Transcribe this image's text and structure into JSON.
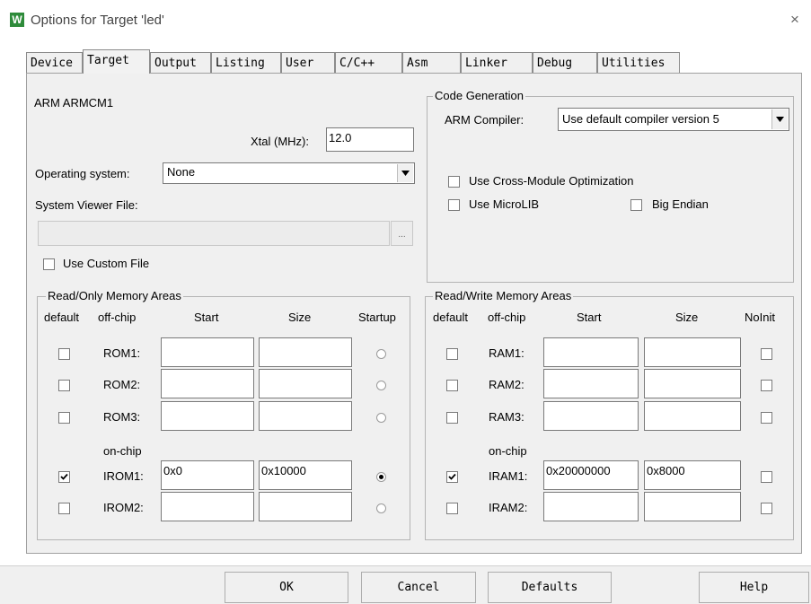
{
  "window": {
    "title": "Options for Target 'led'",
    "close_glyph": "×",
    "app_icon_letter": "W"
  },
  "tabs": [
    "Device",
    "Target",
    "Output",
    "Listing",
    "User",
    "C/C++",
    "Asm",
    "Linker",
    "Debug",
    "Utilities"
  ],
  "active_tab": "Target",
  "target": {
    "device_name": "ARM ARMCM1",
    "xtal_label": "Xtal (MHz):",
    "xtal_value": "12.0",
    "os_label": "Operating system:",
    "os_value": "None",
    "svf_label": "System Viewer File:",
    "svf_value": "",
    "browse_label": "...",
    "use_custom_file_label": "Use Custom File",
    "use_custom_file_checked": false
  },
  "code_generation": {
    "legend": "Code Generation",
    "compiler_label": "ARM Compiler:",
    "compiler_value": "Use default compiler version 5",
    "cross_module_label": "Use Cross-Module Optimization",
    "cross_module_checked": false,
    "microlib_label": "Use MicroLIB",
    "microlib_checked": false,
    "big_endian_label": "Big Endian",
    "big_endian_checked": false
  },
  "rom": {
    "legend": "Read/Only Memory Areas",
    "headers": {
      "default": "default",
      "offchip": "off-chip",
      "start": "Start",
      "size": "Size",
      "last": "Startup"
    },
    "onchip_label": "on-chip",
    "rows": [
      {
        "label": "ROM1:",
        "default": false,
        "start": "",
        "size": "",
        "startup": false
      },
      {
        "label": "ROM2:",
        "default": false,
        "start": "",
        "size": "",
        "startup": false
      },
      {
        "label": "ROM3:",
        "default": false,
        "start": "",
        "size": "",
        "startup": false
      },
      {
        "label": "IROM1:",
        "default": true,
        "start": "0x0",
        "size": "0x10000",
        "startup": true
      },
      {
        "label": "IROM2:",
        "default": false,
        "start": "",
        "size": "",
        "startup": false
      }
    ]
  },
  "ram": {
    "legend": "Read/Write Memory Areas",
    "headers": {
      "default": "default",
      "offchip": "off-chip",
      "start": "Start",
      "size": "Size",
      "last": "NoInit"
    },
    "onchip_label": "on-chip",
    "rows": [
      {
        "label": "RAM1:",
        "default": false,
        "start": "",
        "size": "",
        "noinit": false
      },
      {
        "label": "RAM2:",
        "default": false,
        "start": "",
        "size": "",
        "noinit": false
      },
      {
        "label": "RAM3:",
        "default": false,
        "start": "",
        "size": "",
        "noinit": false
      },
      {
        "label": "IRAM1:",
        "default": true,
        "start": "0x20000000",
        "size": "0x8000",
        "noinit": false
      },
      {
        "label": "IRAM2:",
        "default": false,
        "start": "",
        "size": "",
        "noinit": false
      }
    ]
  },
  "buttons": {
    "ok": "OK",
    "cancel": "Cancel",
    "defaults": "Defaults",
    "help": "Help"
  }
}
